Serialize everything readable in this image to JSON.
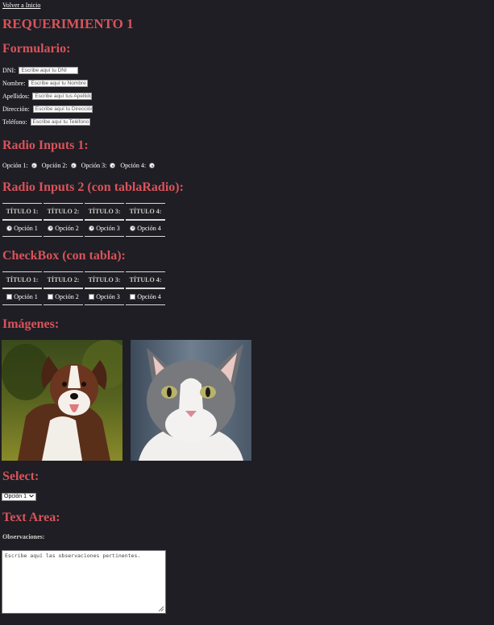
{
  "nav": {
    "back_link": "Volver a Inicio"
  },
  "page_title": "REQUERIMIENTO 1",
  "form": {
    "heading": "Formulario:",
    "fields": [
      {
        "label": "DNI:",
        "placeholder": "Escribe aquí tu DNI"
      },
      {
        "label": "Nombre:",
        "placeholder": "Escribe aquí tu Nombre"
      },
      {
        "label": "Apellidos:",
        "placeholder": "Escribe aquí tus Apellidos"
      },
      {
        "label": "Dirección:",
        "placeholder": "Escribe aquí tu Dirección"
      },
      {
        "label": "Teléfono:",
        "placeholder": "Escribe aquí tu Teléfono"
      }
    ]
  },
  "radio1": {
    "heading": "Radio Inputs 1:",
    "options": [
      "Opción 1:",
      "Opción 2:",
      "Opción 3:",
      "Opción 4:"
    ]
  },
  "radio2": {
    "heading": "Radio Inputs 2 (con tablaRadio):",
    "headers": [
      "TÍTULO 1:",
      "TÍTULO 2:",
      "TÍTULO 3:",
      "TÍTULO 4:"
    ],
    "options": [
      "Opción 1",
      "Opción 2",
      "Opción 3",
      "Opción 4"
    ]
  },
  "checkbox": {
    "heading": "CheckBox (con tabla):",
    "headers": [
      "TÍTULO 1:",
      "TÍTULO 2:",
      "TÍTULO 3:",
      "TÍTULO 4:"
    ],
    "options": [
      "Opción 1",
      "Opción 2",
      "Opción 3",
      "Opción 4"
    ]
  },
  "images": {
    "heading": "Imágenes:"
  },
  "select": {
    "heading": "Select:",
    "value": "Opción 1"
  },
  "textarea": {
    "heading": "Text Area:",
    "label": "Observaciones:",
    "placeholder": "Escribe aquí las observaciones pertinentes."
  },
  "colors": {
    "background": "#1e1e24",
    "heading": "#d9535a",
    "text": "#ffffff"
  }
}
